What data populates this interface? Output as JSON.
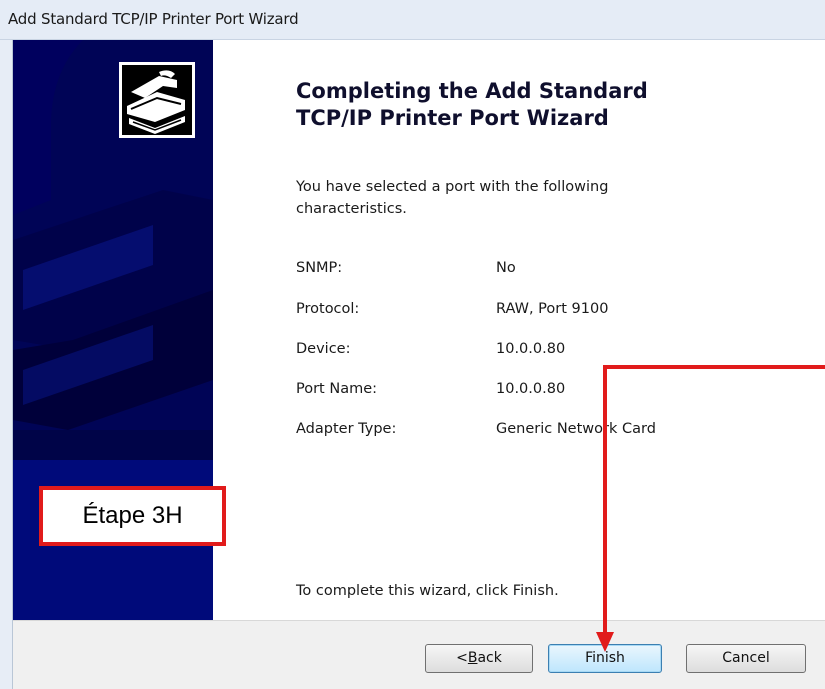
{
  "window": {
    "title": "Add Standard TCP/IP Printer Port Wizard"
  },
  "wizard": {
    "heading_line1": "Completing the Add Standard",
    "heading_line2": "TCP/IP Printer Port Wizard",
    "intro": "You have selected a port with the following characteristics.",
    "properties": [
      {
        "label": "SNMP:",
        "value": "No"
      },
      {
        "label": "Protocol:",
        "value": "RAW, Port 9100"
      },
      {
        "label": "Device:",
        "value": "10.0.0.80"
      },
      {
        "label": "Port Name:",
        "value": "10.0.0.80"
      },
      {
        "label": "Adapter Type:",
        "value": "Generic Network Card"
      }
    ],
    "finish_note": "To complete this wizard, click Finish."
  },
  "buttons": {
    "back_prefix": "",
    "back_accel": "B",
    "back_rest": "ack",
    "back_arrow": "<",
    "finish": "Finish",
    "cancel": "Cancel"
  },
  "annotation": {
    "label": "Étape 3H",
    "color": "#e11b1b"
  },
  "colors": {
    "sidebar": "#000a7a",
    "sidebar_dark": "#00003a"
  },
  "icons": {
    "wizard_logo": "printer-hand-icon"
  }
}
